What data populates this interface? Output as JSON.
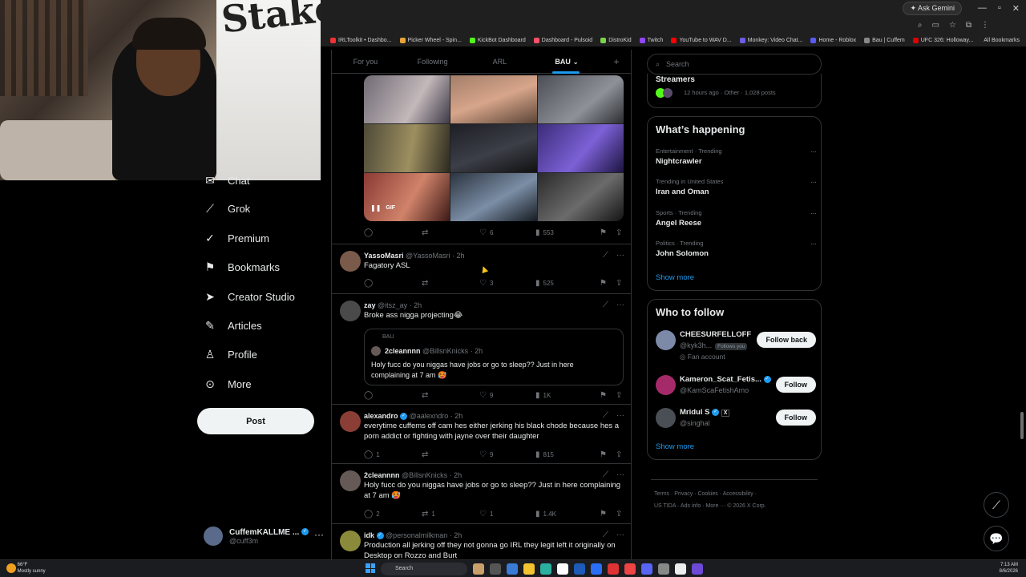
{
  "browser": {
    "ask_gemini": "Ask Gemini",
    "bookmarks": [
      "IRLToolkit • Dashbo...",
      "Picker Wheel - Spin...",
      "KickBot Dashboard",
      "Dashboard - Pulsoid",
      "DistroKid",
      "Twitch",
      "YouTube to WAV D...",
      "Monkey: Video Chat...",
      "Home - Roblox",
      "Bau | Cuffem",
      "UFC 326: Holloway..."
    ],
    "all_bookmarks": "All Bookmarks"
  },
  "nav": {
    "chat": "Chat",
    "grok": "Grok",
    "premium": "Premium",
    "bookmarks": "Bookmarks",
    "creator_studio": "Creator Studio",
    "articles": "Articles",
    "profile": "Profile",
    "more": "More",
    "post": "Post"
  },
  "account": {
    "name": "CuffemKALLME ...",
    "handle": "@cuff3m"
  },
  "tabs": [
    "For you",
    "Following",
    "ARL",
    "BAU",
    "+"
  ],
  "gif_post": {
    "gif_label": "GIF",
    "likes": "6",
    "views": "553"
  },
  "posts": [
    {
      "name": "YassoMasri",
      "handle": "@YassoMasri · 2h",
      "text": "Fagatory ASL",
      "replies": "",
      "reposts": "",
      "likes": "3",
      "views": "525"
    },
    {
      "name": "zay",
      "handle": "@itsz_ay · 2h",
      "text": "Broke ass nigga projecting😂",
      "quote": {
        "context": "BAU",
        "name": "2cleannnn",
        "handle": "@BillsnKnicks · 2h",
        "text": "Holy fucc do you niggas have jobs or go to sleep?? Just in here complaining at 7 am 🥵"
      },
      "replies": "",
      "reposts": "",
      "likes": "9",
      "views": "1K"
    },
    {
      "name": "alexandro",
      "handle": "@aalexndro · 2h",
      "text": "everytime cuffems off cam hes either jerking his black chode because hes a porn addict or fighting with jayne over their daughter",
      "replies": "1",
      "reposts": "",
      "likes": "9",
      "views": "815"
    },
    {
      "name": "2cleannnn",
      "handle": "@BillsnKnicks · 2h",
      "text": "Holy fucc do you niggas have jobs or go to sleep?? Just in here complaining at 7 am 🥵",
      "replies": "2",
      "reposts": "1",
      "likes": "1",
      "views": "1.4K"
    },
    {
      "name": "idk",
      "handle": "@personalmilkman · 2h",
      "text": "Production all jerking off they not gonna go IRL they legit left it originally on Desktop on Rozzo and Burt",
      "replies": "",
      "reposts": "",
      "likes": "",
      "views": ""
    }
  ],
  "right": {
    "search_placeholder": "Search",
    "community": {
      "name": "Streamers",
      "meta": "12 hours ago · Other · 1,028 posts"
    },
    "whats_happening": "What’s happening",
    "trends": [
      {
        "context": "Entertainment · Trending",
        "name": "Nightcrawler"
      },
      {
        "context": "Trending in United States",
        "name": "Iran and Oman"
      },
      {
        "context": "Sports · Trending",
        "name": "Angel Reese"
      },
      {
        "context": "Politics · Trending",
        "name": "John Solomon"
      }
    ],
    "show_more": "Show more",
    "who_to_follow": "Who to follow",
    "follows": [
      {
        "name": "CHEESURFELLOFF",
        "handle": "@kyk3h...",
        "follows_you": "Follows you",
        "extra": "Fan account",
        "button": "Follow back"
      },
      {
        "name": "Kameron_Scat_Fetis...",
        "handle": "@KamScaFetishAmo",
        "button": "Follow"
      },
      {
        "name": "Mridul S",
        "handle": "@singhal",
        "button": "Follow"
      }
    ],
    "footer_line1": "Terms  ·  Privacy  ·  Cookies  ·  Accessibility  ·",
    "footer_line2": "US TIDA  ·  Ads info  ·  More ···  © 2026 X Corp."
  },
  "taskbar": {
    "temp": "66°F",
    "weather": "Mostly sunny",
    "search": "Search",
    "time": "7:13 AM",
    "date": "8/6/2026"
  }
}
